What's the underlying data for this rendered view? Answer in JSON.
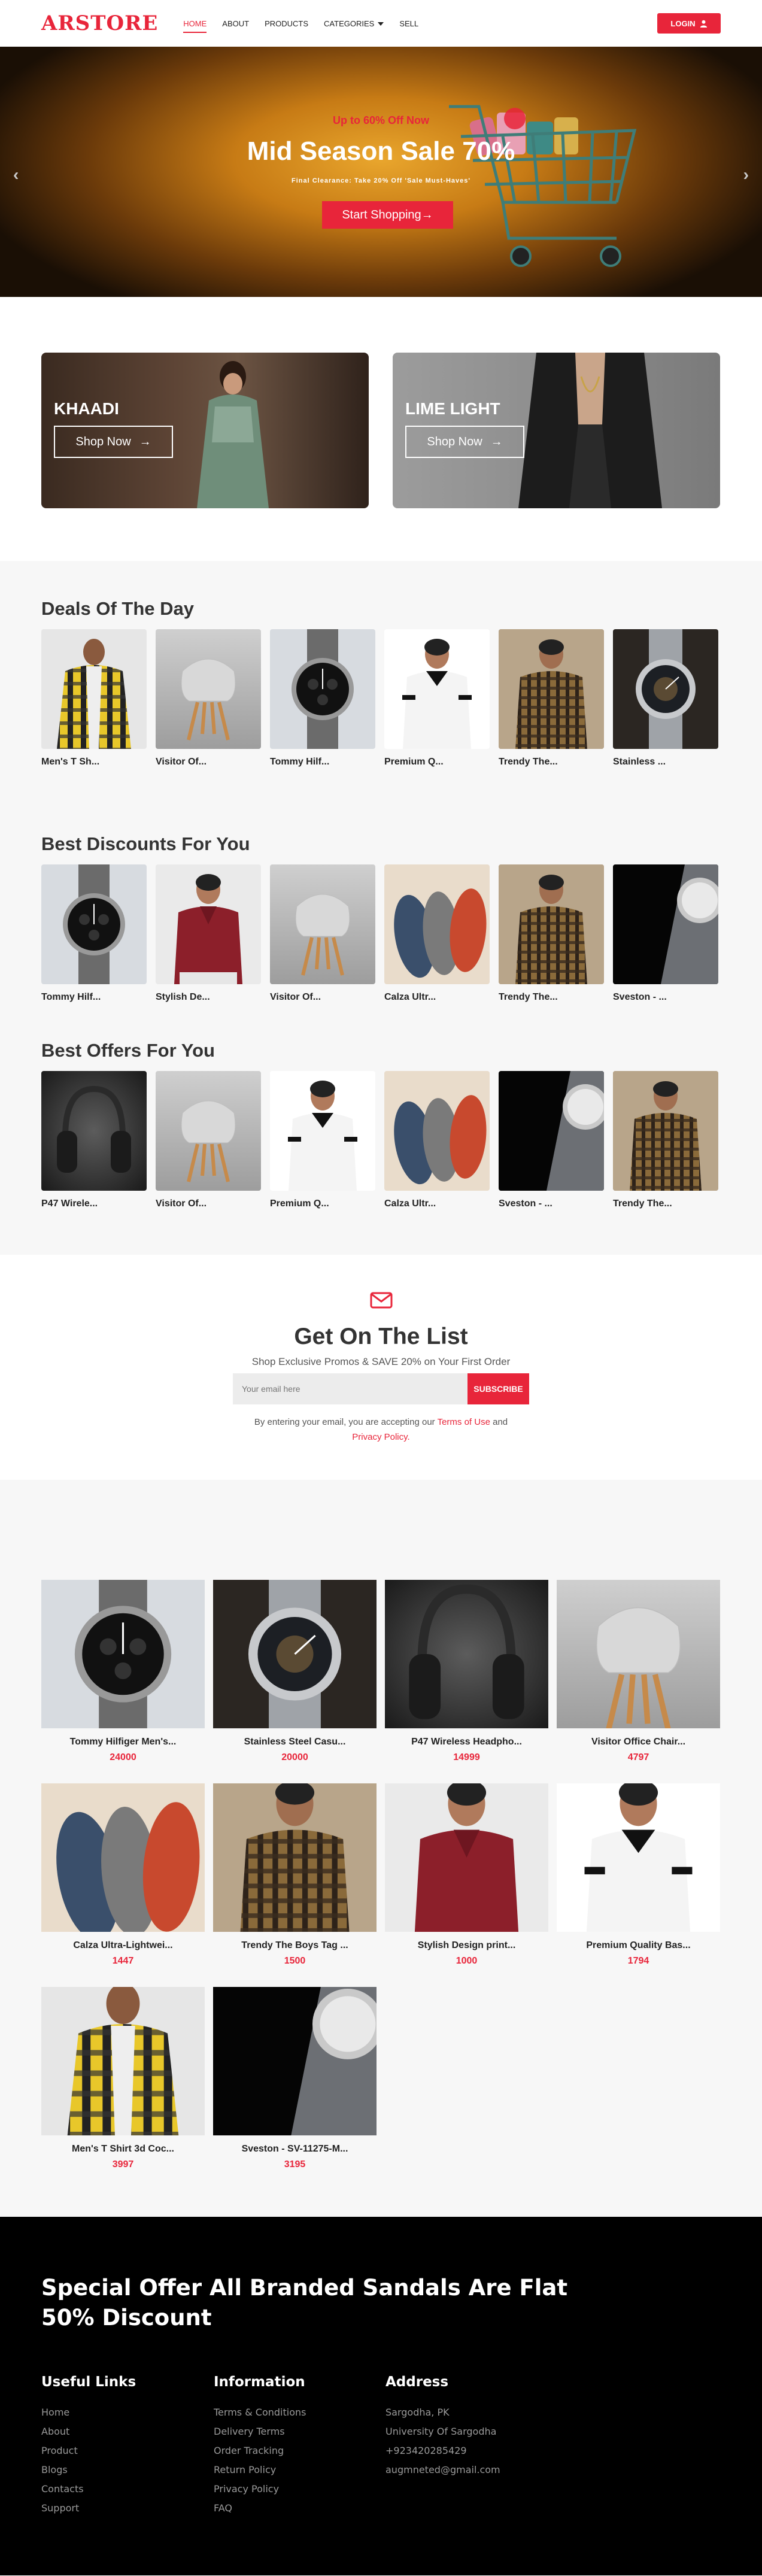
{
  "header": {
    "logo": "ARSTORE",
    "nav": [
      "HOME",
      "ABOUT",
      "PRODUCTS",
      "CATEGORIES",
      "SELL"
    ],
    "login_label": "LOGIN"
  },
  "hero": {
    "promo": "Up to 60% Off Now",
    "title": "Mid Season Sale 70%",
    "subtitle": "Final Clearance: Take 20% Off 'Sale Must-Haves'",
    "cta": "Start Shopping→"
  },
  "brands": [
    {
      "name": "KHAADI",
      "cta": "Shop Now"
    },
    {
      "name": "LIME LIGHT",
      "cta": "Shop Now"
    }
  ],
  "sections": [
    {
      "title": "Deals Of The Day",
      "items": [
        {
          "name": "Men's T Sh...",
          "img": "yellow-shirt"
        },
        {
          "name": "Visitor Of...",
          "img": "chair"
        },
        {
          "name": "Tommy Hilf...",
          "img": "watch-black"
        },
        {
          "name": "Premium Q...",
          "img": "white-polo"
        },
        {
          "name": "Trendy The...",
          "img": "check-shirt"
        },
        {
          "name": "Stainless ...",
          "img": "watch-steel"
        }
      ]
    },
    {
      "title": "Best Discounts For You",
      "items": [
        {
          "name": "Tommy Hilf...",
          "img": "watch-black"
        },
        {
          "name": "Stylish De...",
          "img": "red-polo"
        },
        {
          "name": "Visitor Of...",
          "img": "chair"
        },
        {
          "name": "Calza Ultr...",
          "img": "loafers"
        },
        {
          "name": "Trendy The...",
          "img": "check-shirt"
        },
        {
          "name": "Sveston - ...",
          "img": "watch-dark"
        }
      ]
    },
    {
      "title": "Best Offers For You",
      "items": [
        {
          "name": "P47 Wirele...",
          "img": "headphones"
        },
        {
          "name": "Visitor Of...",
          "img": "chair"
        },
        {
          "name": "Premium Q...",
          "img": "white-polo"
        },
        {
          "name": "Calza Ultr...",
          "img": "loafers"
        },
        {
          "name": "Sveston - ...",
          "img": "watch-dark"
        },
        {
          "name": "Trendy The...",
          "img": "check-shirt"
        }
      ]
    }
  ],
  "newsletter": {
    "title": "Get On The List",
    "subtitle": "Shop Exclusive Promos & SAVE 20% on Your First Order",
    "placeholder": "Your email here",
    "button": "SUBSCRIBE",
    "terms_prefix": "By entering your email, you are accepting our",
    "terms_link": "Terms of Use",
    "and": "and",
    "privacy_link": "Privacy Policy."
  },
  "products": [
    {
      "name": "Tommy Hilfiger Men's...",
      "price": "24000",
      "img": "watch-black"
    },
    {
      "name": "Stainless Steel Casu...",
      "price": "20000",
      "img": "watch-steel"
    },
    {
      "name": "P47 Wireless Headpho...",
      "price": "14999",
      "img": "headphones"
    },
    {
      "name": "Visitor Office Chair...",
      "price": "4797",
      "img": "chair"
    },
    {
      "name": "Calza Ultra-Lightwei...",
      "price": "1447",
      "img": "loafers"
    },
    {
      "name": "Trendy The Boys Tag ...",
      "price": "1500",
      "img": "check-shirt"
    },
    {
      "name": "Stylish Design print...",
      "price": "1000",
      "img": "red-polo"
    },
    {
      "name": "Premium Quality Bas...",
      "price": "1794",
      "img": "white-polo"
    },
    {
      "name": "Men's T Shirt 3d Coc...",
      "price": "3997",
      "img": "yellow-shirt"
    },
    {
      "name": "Sveston - SV-11275-M...",
      "price": "3195",
      "img": "watch-dark"
    }
  ],
  "footer": {
    "headline": "Special Offer All Branded Sandals Are Flat 50% Discount",
    "columns": [
      {
        "title": "Useful Links",
        "links": [
          "Home",
          "About",
          "Product",
          "Blogs",
          "Contacts",
          "Support"
        ]
      },
      {
        "title": "Information",
        "links": [
          "Terms & Conditions",
          "Delivery Terms",
          "Order Tracking",
          "Return Policy",
          "Privacy Policy",
          "FAQ"
        ]
      },
      {
        "title": "Address",
        "links": [
          "Sargodha, PK",
          "University Of Sargodha",
          "+923420285429",
          "augmneted@gmail.com"
        ]
      }
    ]
  },
  "colors": {
    "accent": "#e8253a",
    "footer_bg": "#000000",
    "section_bg": "#f7f7f7"
  }
}
